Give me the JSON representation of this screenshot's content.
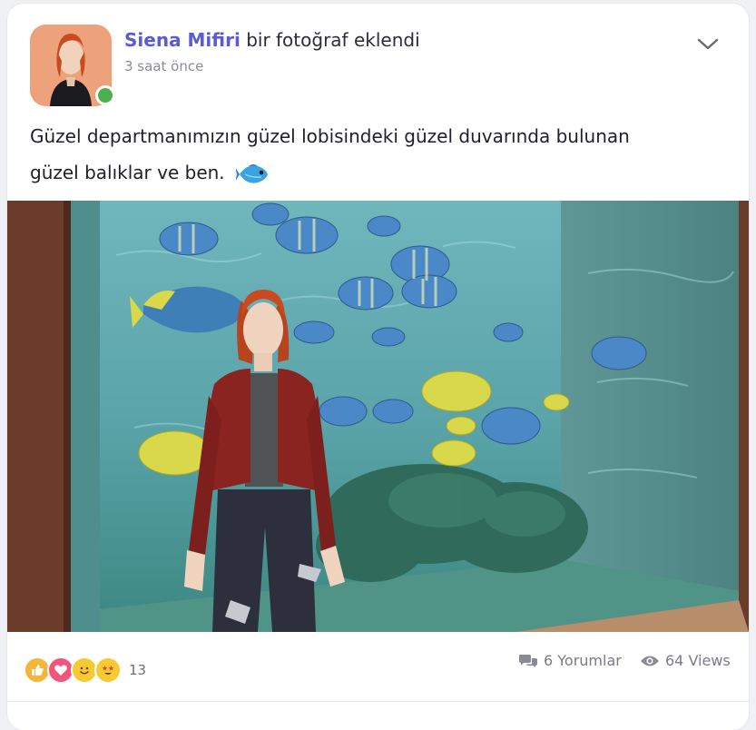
{
  "post": {
    "author": "Siena Mifiri",
    "action": "bir fotoğraf eklendi",
    "time": "3 saat önce",
    "text_line1": "Güzel departmanımızın güzel lobisindeki güzel duvarında bulunan",
    "text_line2": "güzel balıklar ve ben.",
    "emoji": "fish-icon"
  },
  "reactions": {
    "icons": [
      "like-icon",
      "love-icon",
      "smile-icon",
      "star-eyes-icon"
    ],
    "count": "13"
  },
  "stats": {
    "comments": "6 Yorumlar",
    "views": "64 Views"
  },
  "colors": {
    "author": "#5b5bd6",
    "online": "#4caf50"
  }
}
